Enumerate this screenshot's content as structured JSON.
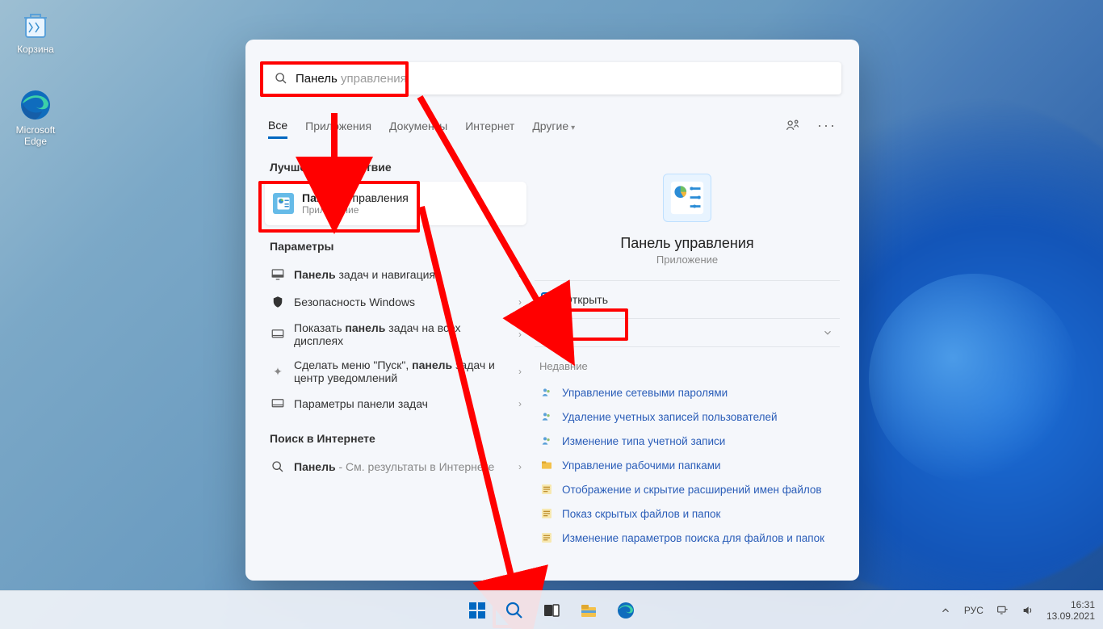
{
  "desktop": {
    "recycle_bin": "Корзина",
    "edge": "Microsoft Edge"
  },
  "search": {
    "typed": "Панель",
    "suggestion": " управления"
  },
  "tabs": {
    "all": "Все",
    "apps": "Приложения",
    "docs": "Документы",
    "web": "Интернет",
    "more": "Другие"
  },
  "sections": {
    "best_match": "Лучшее соответствие",
    "settings": "Параметры",
    "web_search": "Поиск в Интернете"
  },
  "best": {
    "title_bold": "Панель",
    "title_rest": " управления",
    "sub": "Приложение"
  },
  "settings_rows": {
    "r1_bold": "Панель",
    "r1_rest": " задач и навигация",
    "r2": "Безопасность Windows",
    "r3_pre": "Показать ",
    "r3_bold": "панель",
    "r3_rest": " задач на всех дисплеях",
    "r4_pre": "Сделать меню \"Пуск\", ",
    "r4_bold": "панель",
    "r4_rest": " задач и центр уведомлений",
    "r5": "Параметры панели задач"
  },
  "web_row": {
    "bold": "Панель",
    "rest": " - См. результаты в Интернете"
  },
  "preview": {
    "title": "Панель управления",
    "sub": "Приложение",
    "open": "Открыть",
    "recents": "Недавние",
    "items": {
      "i0": "Управление сетевыми паролями",
      "i1": "Удаление учетных записей пользователей",
      "i2": "Изменение типа учетной записи",
      "i3": "Управление рабочими папками",
      "i4": "Отображение и скрытие расширений имен файлов",
      "i5": "Показ скрытых файлов и папок",
      "i6": "Изменение параметров поиска для файлов и папок"
    }
  },
  "tray": {
    "lang": "РУС",
    "time": "16:31",
    "date": "13.09.2021"
  }
}
